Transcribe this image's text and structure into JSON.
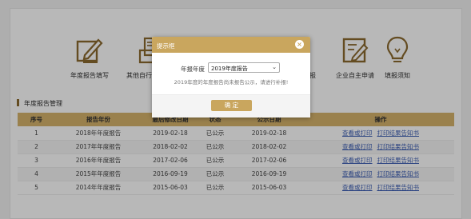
{
  "menu": {
    "items": [
      {
        "label": "年度报告填写",
        "icon": "pencil-square-icon"
      },
      {
        "label": "其他自行公示信息",
        "icon": "document-tray-icon"
      },
      {
        "label": "",
        "icon": "hidden-behind-dialog"
      },
      {
        "label": "填报",
        "icon": "hidden-behind-dialog"
      },
      {
        "label": "企业自主申请",
        "icon": "edit-document-icon"
      },
      {
        "label": "填报须知",
        "icon": "lightbulb-icon"
      }
    ]
  },
  "section": {
    "title": "年度报告管理"
  },
  "table": {
    "headers": [
      "序号",
      "报告年份",
      "最后修改日期",
      "状态",
      "公示日期",
      "操作"
    ],
    "rows": [
      {
        "num": "1",
        "year": "2018年年度报告",
        "modified": "2019-02-18",
        "status": "已公示",
        "published": "2019-02-18",
        "action1": "查看或打印",
        "action2": "打印结果告知书"
      },
      {
        "num": "2",
        "year": "2017年年度报告",
        "modified": "2018-02-02",
        "status": "已公示",
        "published": "2018-02-02",
        "action1": "查看或打印",
        "action2": "打印结果告知书"
      },
      {
        "num": "3",
        "year": "2016年年度报告",
        "modified": "2017-02-06",
        "status": "已公示",
        "published": "2017-02-06",
        "action1": "查看或打印",
        "action2": "打印结果告知书"
      },
      {
        "num": "4",
        "year": "2015年年度报告",
        "modified": "2016-09-19",
        "status": "已公示",
        "published": "2016-09-19",
        "action1": "查看或打印",
        "action2": "打印结果告知书"
      },
      {
        "num": "5",
        "year": "2014年年度报告",
        "modified": "2015-06-03",
        "status": "已公示",
        "published": "2015-06-03",
        "action1": "查看或打印",
        "action2": "打印结果告知书"
      }
    ]
  },
  "dialog": {
    "title": "提示框",
    "close": "×",
    "label": "年报年度",
    "select_value": "2019年度报告",
    "message": "2019年度的年度报告尚未报告公示，请进行补报!",
    "confirm": "确 定"
  },
  "colors": {
    "accent": "#c9a65e",
    "icon": "#8b6a2f",
    "link": "#3d5fb4"
  }
}
